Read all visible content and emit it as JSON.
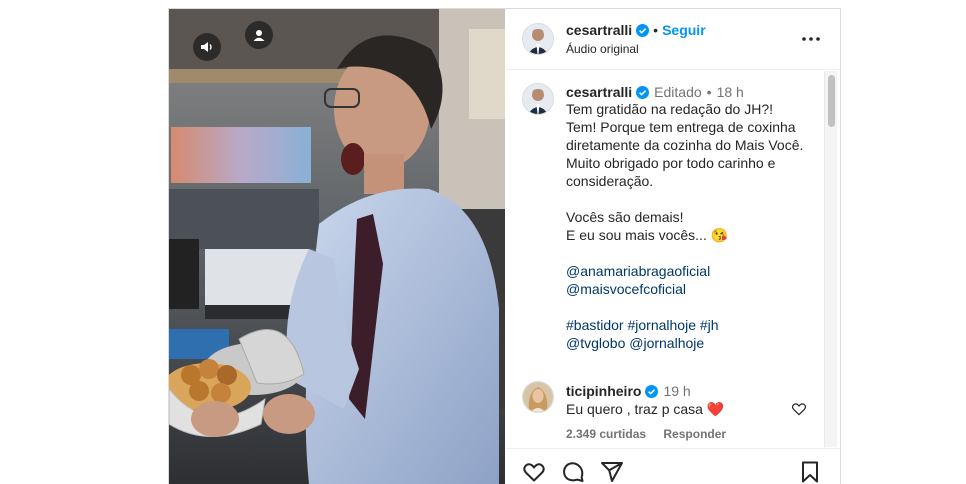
{
  "header": {
    "username": "cesartralli",
    "separator": "•",
    "follow_label": "Seguir",
    "audio_label": "Áudio original"
  },
  "caption": {
    "username": "cesartralli",
    "edited_label": "Editado",
    "separator": "•",
    "time": "18 h",
    "lines": [
      "Tem gratidão na redação do JH?!",
      "Tem! Porque tem entrega de coxinha",
      "diretamente da cozinha do Mais Você.",
      "Muito obrigado por todo carinho e",
      "consideração."
    ],
    "line_demais": "Vocês são demais!",
    "line_eu_sou": "E eu sou mais vocês... 😘",
    "mentions": [
      "@anamariabragaoficial",
      "@maisvocefcoficial"
    ],
    "hashtags_line": [
      "#bastidor",
      "#jornalhoje",
      "#jh"
    ],
    "mentions_line2": [
      "@tvglobo",
      "@jornalhoje"
    ]
  },
  "comment": {
    "username": "ticipinheiro",
    "time": "19 h",
    "text": "Eu quero , traz p casa ❤️",
    "likes": "2.349 curtidas",
    "reply_label": "Responder"
  },
  "icons": {
    "mute": "volume-icon",
    "tags": "user-tag-icon",
    "more": "more-horizontal-icon",
    "like": "heart-icon",
    "comment": "comment-bubble-icon",
    "share": "paper-plane-icon",
    "save": "bookmark-icon",
    "verified": "verified-badge-icon"
  },
  "colors": {
    "accent": "#0095f6",
    "link": "#00376b",
    "muted": "#737373",
    "verified": "#0095f6"
  }
}
